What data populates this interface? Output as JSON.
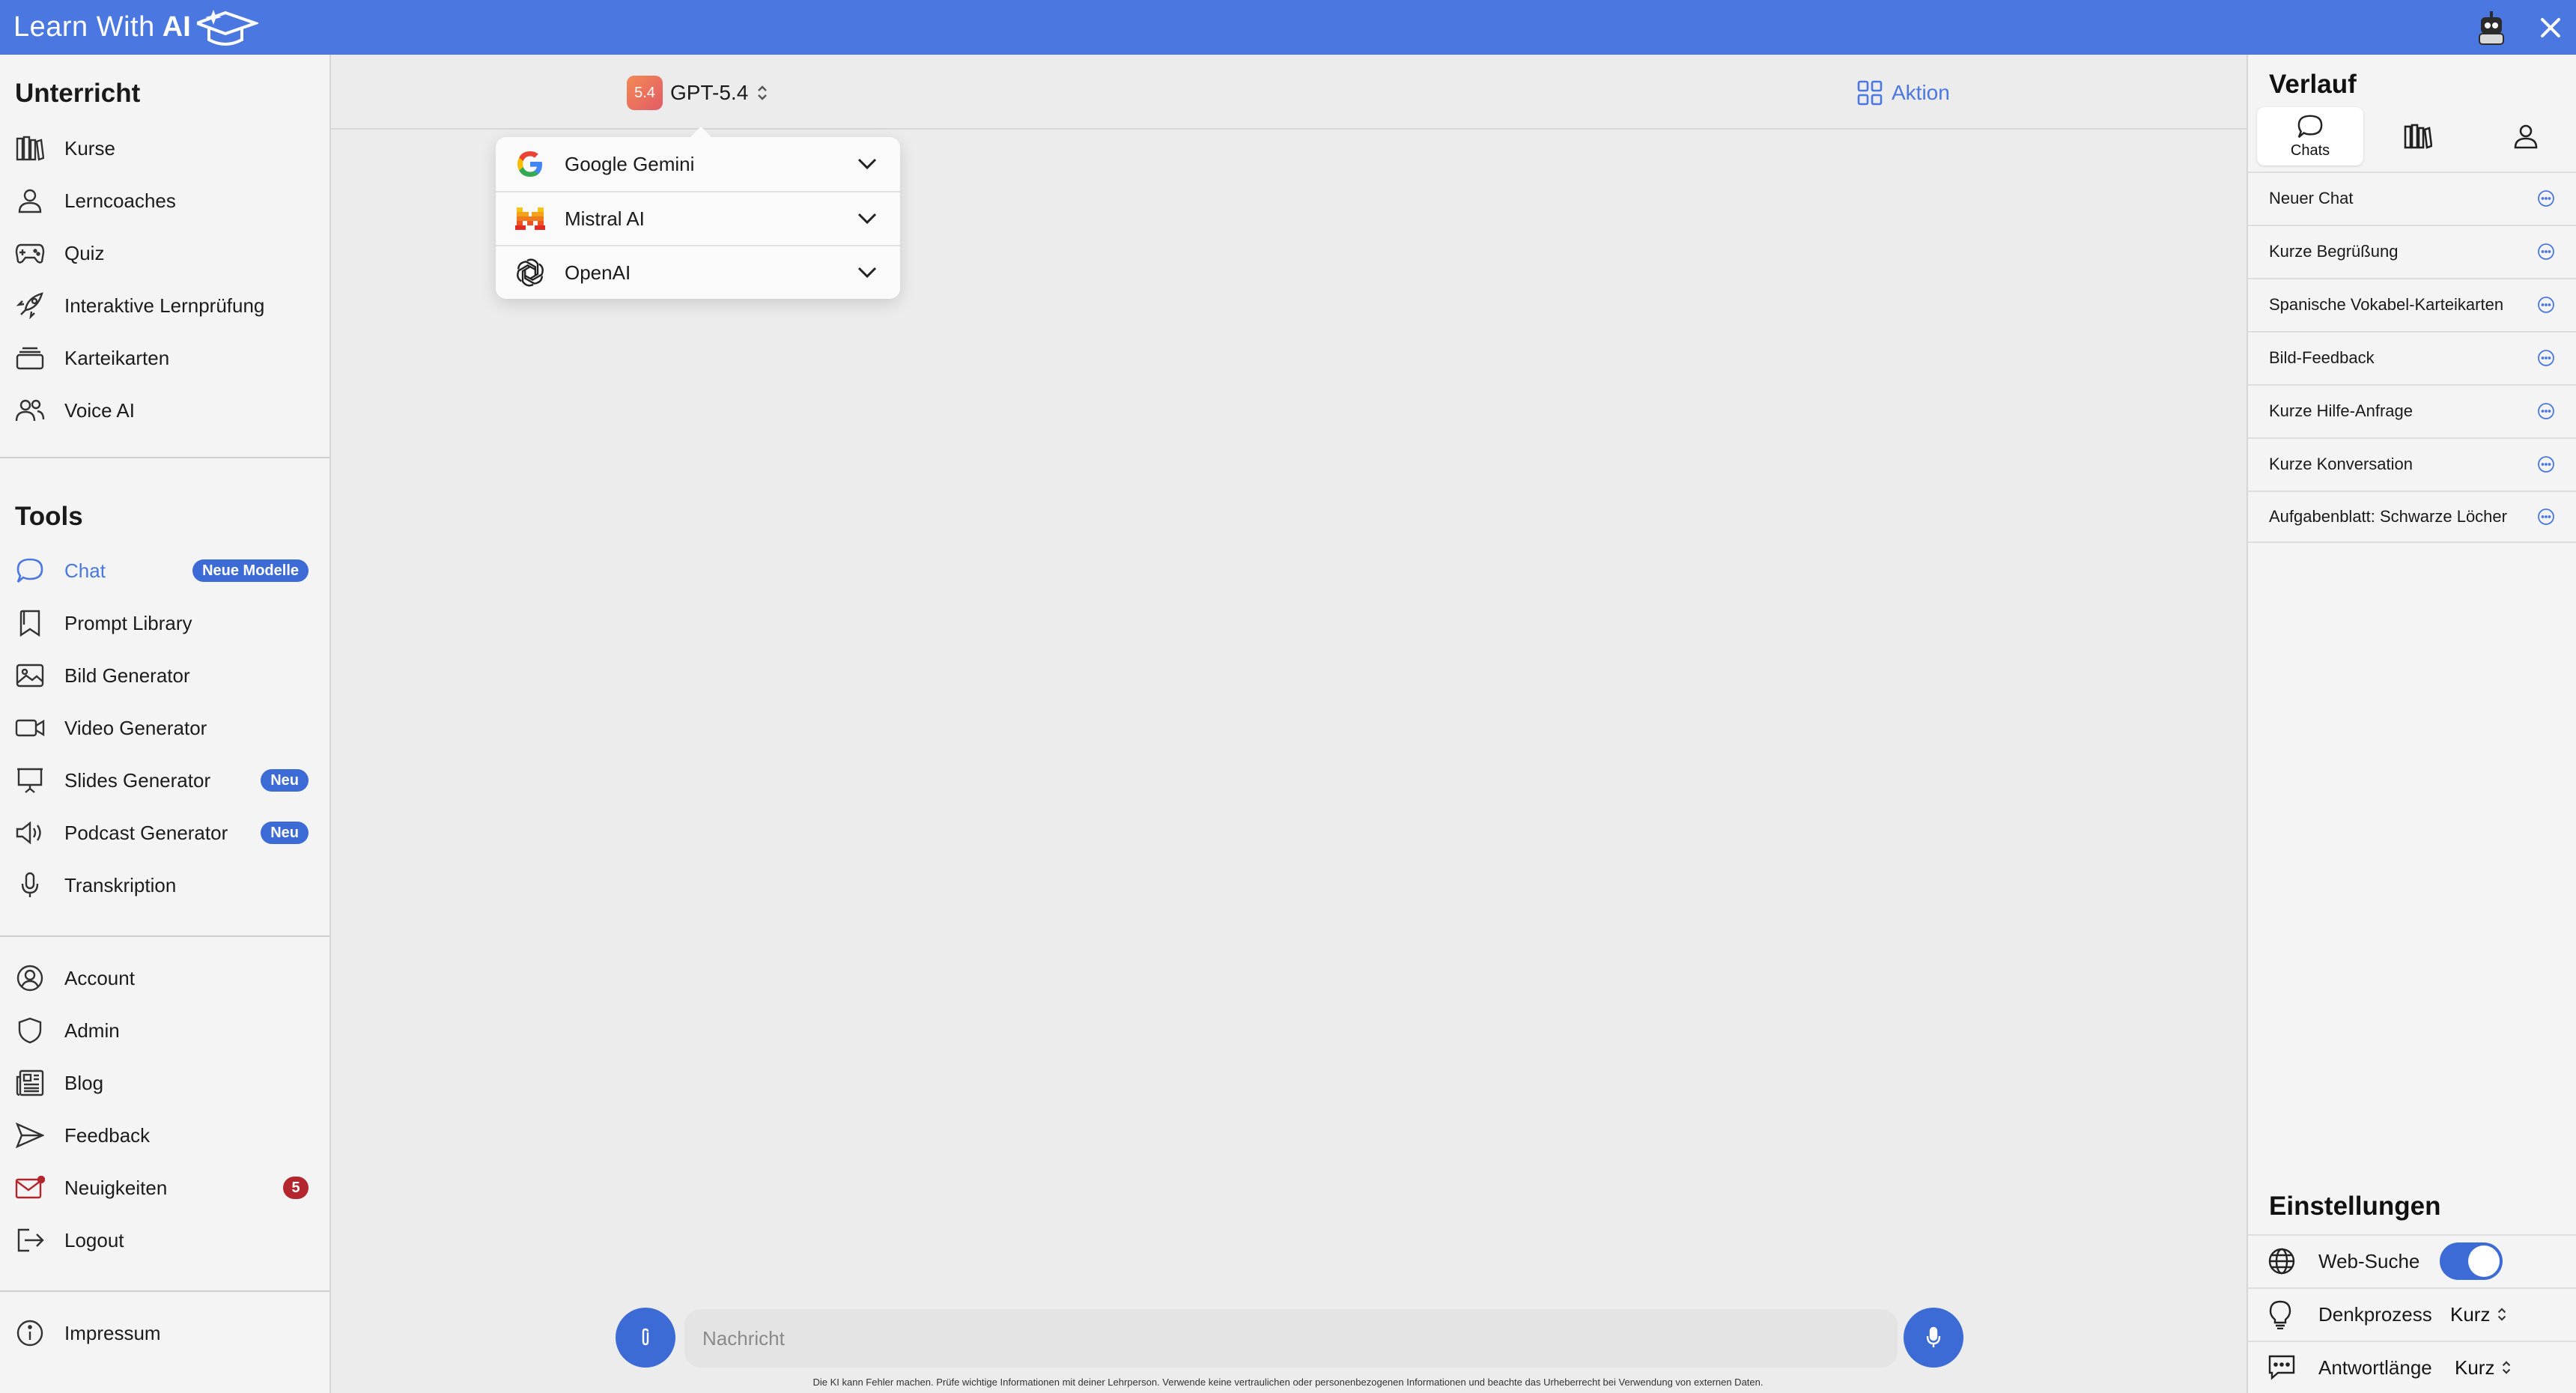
{
  "brand": {
    "text": "Learn With",
    "ai": "AI"
  },
  "sidebar": {
    "sections": {
      "unterricht": "Unterricht",
      "tools": "Tools"
    },
    "unterricht_items": [
      {
        "label": "Kurse",
        "icon": "books-icon"
      },
      {
        "label": "Lerncoaches",
        "icon": "person-icon"
      },
      {
        "label": "Quiz",
        "icon": "gamepad-icon"
      },
      {
        "label": "Interaktive Lernprüfung",
        "icon": "rocket-icon"
      },
      {
        "label": "Karteikarten",
        "icon": "cards-icon"
      },
      {
        "label": "Voice AI",
        "icon": "users-icon"
      }
    ],
    "tools_items": [
      {
        "label": "Chat",
        "icon": "chat-bubble-icon",
        "badge": "Neue Modelle"
      },
      {
        "label": "Prompt Library",
        "icon": "bookmark-icon"
      },
      {
        "label": "Bild Generator",
        "icon": "image-icon"
      },
      {
        "label": "Video Generator",
        "icon": "video-icon"
      },
      {
        "label": "Slides Generator",
        "icon": "presentation-icon",
        "badge": "Neu"
      },
      {
        "label": "Podcast Generator",
        "icon": "speaker-icon",
        "badge": "Neu"
      },
      {
        "label": "Transkription",
        "icon": "microphone-icon"
      }
    ],
    "account_items": [
      {
        "label": "Account",
        "icon": "user-circle-icon"
      },
      {
        "label": "Admin",
        "icon": "shield-icon"
      },
      {
        "label": "Blog",
        "icon": "newspaper-icon"
      },
      {
        "label": "Feedback",
        "icon": "send-icon"
      },
      {
        "label": "Neuigkeiten",
        "icon": "mail-icon",
        "badge": "5"
      },
      {
        "label": "Logout",
        "icon": "logout-icon"
      }
    ],
    "footer_items": [
      {
        "label": "Impressum",
        "icon": "info-icon"
      }
    ]
  },
  "main": {
    "model": {
      "badge": "5.4",
      "name": "GPT-5.4"
    },
    "action_label": "Aktion",
    "providers": [
      {
        "label": "Google Gemini",
        "icon": "google-logo-icon"
      },
      {
        "label": "Mistral AI",
        "icon": "mistral-logo-icon"
      },
      {
        "label": "OpenAI",
        "icon": "openai-logo-icon"
      }
    ],
    "composer": {
      "placeholder": "Nachricht"
    },
    "disclaimer": "Die KI kann Fehler machen. Prüfe wichtige Informationen mit deiner Lehrperson. Verwende keine vertraulichen oder personenbezogenen Informationen und beachte das Urheberrecht bei Verwendung von externen Daten."
  },
  "history": {
    "title": "Verlauf",
    "tabs": [
      {
        "label": "Chats",
        "icon": "chat-bubble-icon"
      },
      {
        "label": "",
        "icon": "library-icon"
      },
      {
        "label": "",
        "icon": "person-icon"
      }
    ],
    "items": [
      "Neuer Chat",
      "Kurze Begrüßung",
      "Spanische Vokabel-Karteikarten",
      "Bild-Feedback",
      "Kurze Hilfe-Anfrage",
      "Kurze Konversation",
      "Aufgabenblatt: Schwarze Löcher"
    ]
  },
  "settings": {
    "title": "Einstellungen",
    "web_search": {
      "label": "Web-Suche",
      "enabled": true
    },
    "thinking": {
      "label": "Denkprozess",
      "value": "Kurz"
    },
    "answer_length": {
      "label": "Antwortlänge",
      "value": "Kurz"
    }
  },
  "colors": {
    "accent": "#4a77e0",
    "button": "#3d6bd6",
    "badge_red": "#b3262d"
  }
}
